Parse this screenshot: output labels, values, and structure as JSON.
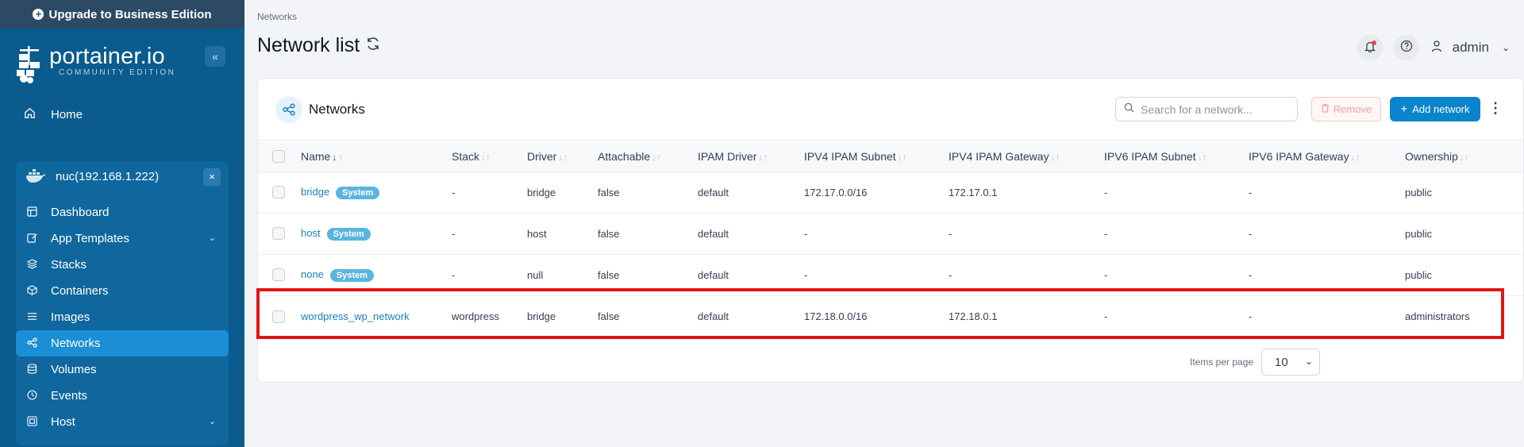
{
  "upgrade": {
    "label": "Upgrade to Business Edition"
  },
  "logo": {
    "main": "portainer.io",
    "sub": "COMMUNITY EDITION"
  },
  "sidebar": {
    "collapse_icon": "«",
    "home_label": "Home",
    "environment": {
      "name": "nuc(192.168.1.222)",
      "close_icon": "×"
    },
    "items": [
      {
        "label": "Dashboard",
        "icon": "dashboard-icon"
      },
      {
        "label": "App Templates",
        "icon": "edit-icon",
        "expandable": true
      },
      {
        "label": "Stacks",
        "icon": "stacks-icon"
      },
      {
        "label": "Containers",
        "icon": "box-icon"
      },
      {
        "label": "Images",
        "icon": "list-icon"
      },
      {
        "label": "Networks",
        "icon": "network-icon",
        "active": true
      },
      {
        "label": "Volumes",
        "icon": "database-icon"
      },
      {
        "label": "Events",
        "icon": "clock-icon"
      },
      {
        "label": "Host",
        "icon": "host-icon",
        "expandable": true
      }
    ]
  },
  "breadcrumb": "Networks",
  "page_title": "Network list",
  "user": {
    "name": "admin"
  },
  "card": {
    "title": "Networks",
    "search_placeholder": "Search for a network...",
    "remove_label": "Remove",
    "add_label": "Add network"
  },
  "table": {
    "columns": [
      "Name",
      "Stack",
      "Driver",
      "Attachable",
      "IPAM Driver",
      "IPV4 IPAM Subnet",
      "IPV4 IPAM Gateway",
      "IPV6 IPAM Subnet",
      "IPV6 IPAM Gateway",
      "Ownership"
    ],
    "rows": [
      {
        "name": "bridge",
        "badge": "System",
        "stack": "-",
        "driver": "bridge",
        "attachable": "false",
        "ipam_driver": "default",
        "ipv4_subnet": "172.17.0.0/16",
        "ipv4_gateway": "172.17.0.1",
        "ipv6_subnet": "-",
        "ipv6_gateway": "-",
        "ownership": "public"
      },
      {
        "name": "host",
        "badge": "System",
        "stack": "-",
        "driver": "host",
        "attachable": "false",
        "ipam_driver": "default",
        "ipv4_subnet": "-",
        "ipv4_gateway": "-",
        "ipv6_subnet": "-",
        "ipv6_gateway": "-",
        "ownership": "public"
      },
      {
        "name": "none",
        "badge": "System",
        "stack": "-",
        "driver": "null",
        "attachable": "false",
        "ipam_driver": "default",
        "ipv4_subnet": "-",
        "ipv4_gateway": "-",
        "ipv6_subnet": "-",
        "ipv6_gateway": "-",
        "ownership": "public"
      },
      {
        "name": "wordpress_wp_network",
        "badge": "",
        "stack": "wordpress",
        "driver": "bridge",
        "attachable": "false",
        "ipam_driver": "default",
        "ipv4_subnet": "172.18.0.0/16",
        "ipv4_gateway": "172.18.0.1",
        "ipv6_subnet": "-",
        "ipv6_gateway": "-",
        "ownership": "administrators"
      }
    ]
  },
  "pagination": {
    "label": "Items per page",
    "value": "10"
  },
  "colors": {
    "sidebar": "#0b5b8e",
    "accent": "#0a84cc",
    "highlight": "#e01515",
    "badge": "#5ab4e0"
  }
}
